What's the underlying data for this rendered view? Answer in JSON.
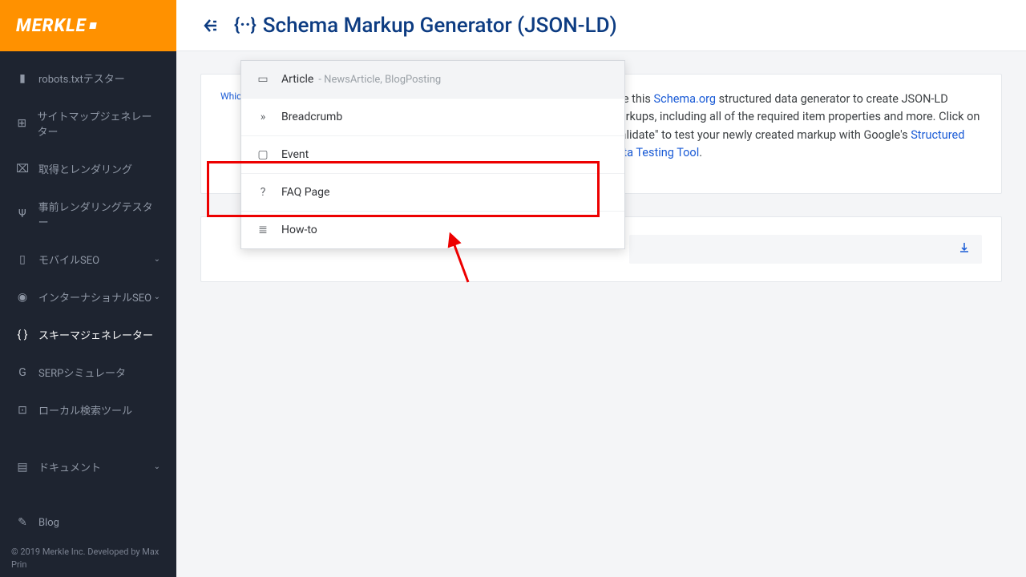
{
  "brand": "MERKLE",
  "header": {
    "title": "Schema Markup Generator (JSON-LD)"
  },
  "sidebar": {
    "items": [
      {
        "icon": "file-icon",
        "glyph": "▮",
        "label": "robots.txtテスター"
      },
      {
        "icon": "sitemap-icon",
        "glyph": "⊞",
        "label": "サイトマップジェネレーター"
      },
      {
        "icon": "fetch-icon",
        "glyph": "⌧",
        "label": "取得とレンダリング"
      },
      {
        "icon": "prerender-icon",
        "glyph": "Ψ",
        "label": "事前レンダリングテスター"
      },
      {
        "icon": "mobile-icon",
        "glyph": "▯",
        "label": "モバイルSEO",
        "chev": true
      },
      {
        "icon": "globe-icon",
        "glyph": "◉",
        "label": "インターナショナルSEO",
        "chev": true
      },
      {
        "icon": "schema-icon",
        "glyph": "{ }",
        "label": "スキーマジェネレーター",
        "active": true
      },
      {
        "icon": "serp-icon",
        "glyph": "G",
        "label": "SERPシミュレータ"
      },
      {
        "icon": "local-icon",
        "glyph": "⊡",
        "label": "ローカル検索ツール"
      },
      {
        "icon": "docs-icon",
        "glyph": "▤",
        "label": "ドキュメント",
        "chev": true,
        "spaced": true
      },
      {
        "icon": "blog-icon",
        "glyph": "✎",
        "label": "Blog",
        "spaced": true
      }
    ]
  },
  "footer": "© 2019 Merkle Inc. Developed by Max Prin",
  "content": {
    "field_label": "Which Schema.org markup would you like to create?",
    "desc_pre": "Use this ",
    "schema_link": "Schema.org",
    "desc_mid": " structured data generator to create JSON-LD markups, including all of the required item properties and more. Click on \"Validate\" to test your newly created markup with Google's ",
    "tool_link": "Structured Data Testing Tool",
    "desc_end": "."
  },
  "dropdown": {
    "items": [
      {
        "icon": "article-icon",
        "glyph": "▭",
        "label": "Article",
        "hint": "- NewsArticle, BlogPosting",
        "selected": true
      },
      {
        "icon": "breadcrumb-icon",
        "glyph": "»",
        "label": "Breadcrumb"
      },
      {
        "icon": "event-icon",
        "glyph": "▢",
        "label": "Event"
      },
      {
        "icon": "faq-icon",
        "glyph": "?",
        "label": "FAQ Page"
      },
      {
        "icon": "howto-icon",
        "glyph": "≣",
        "label": "How-to"
      }
    ]
  }
}
